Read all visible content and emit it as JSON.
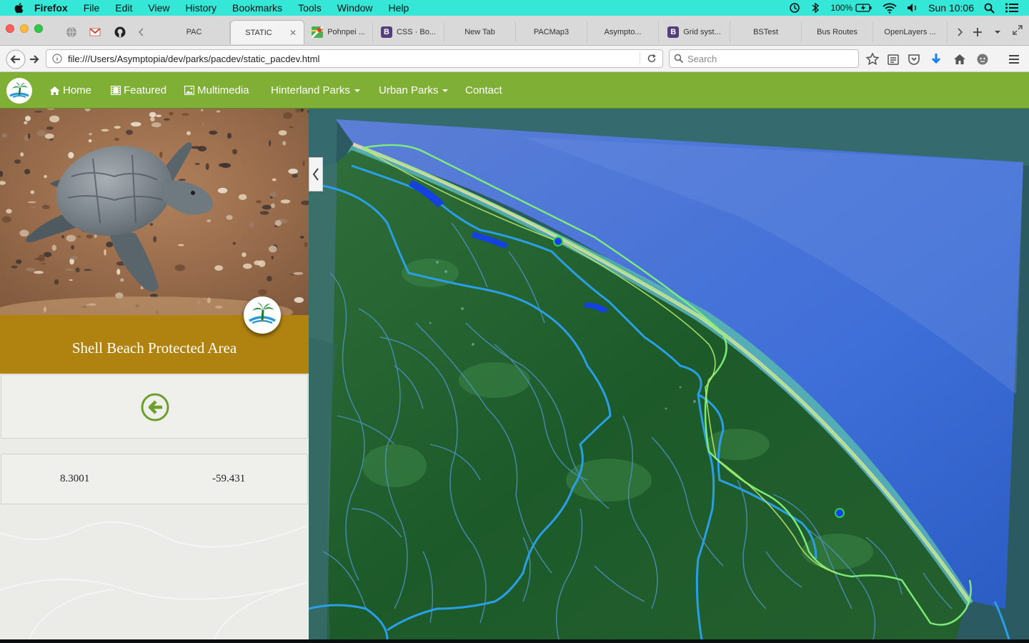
{
  "menubar": {
    "app": "Firefox",
    "items": [
      "File",
      "Edit",
      "View",
      "History",
      "Bookmarks",
      "Tools",
      "Window",
      "Help"
    ],
    "battery": "100%",
    "clock": "Sun 10:06"
  },
  "tabs": [
    {
      "label": "PAC",
      "favicon": "none"
    },
    {
      "label": "STATIC",
      "favicon": "none",
      "active": true
    },
    {
      "label": "Pohnpei ...",
      "favicon": "maps-icon"
    },
    {
      "label": "CSS · Bo...",
      "favicon": "bootstrap-icon"
    },
    {
      "label": "New Tab",
      "favicon": "none"
    },
    {
      "label": "PACMap3",
      "favicon": "none"
    },
    {
      "label": "Asympto...",
      "favicon": "none"
    },
    {
      "label": "Grid syst...",
      "favicon": "bootstrap-icon"
    },
    {
      "label": "BSTest",
      "favicon": "none"
    },
    {
      "label": "Bus Routes",
      "favicon": "none"
    },
    {
      "label": "OpenLayers ...",
      "favicon": "none"
    }
  ],
  "navbar": {
    "url": "file:///Users/Asymptopia/dev/parks/pacdev/static_pacdev.html",
    "search_placeholder": "Search"
  },
  "site": {
    "nav": [
      {
        "label": "Home",
        "icon": "home-icon"
      },
      {
        "label": "Featured",
        "icon": "film-icon"
      },
      {
        "label": "Multimedia",
        "icon": "picture-icon"
      },
      {
        "label": "Hinterland Parks",
        "dropdown": true
      },
      {
        "label": "Urban Parks",
        "dropdown": true
      },
      {
        "label": "Contact"
      }
    ]
  },
  "park": {
    "name": "Shell Beach Protected Area",
    "latitude": "8.3001",
    "longitude": "-59.431"
  },
  "colors": {
    "menubar": "#35e7d7",
    "site_header": "#7faf35",
    "title_band": "#b08311",
    "river": "#2a9fe8",
    "boundary": "#8bf06e",
    "marker": "#1a3cff"
  }
}
